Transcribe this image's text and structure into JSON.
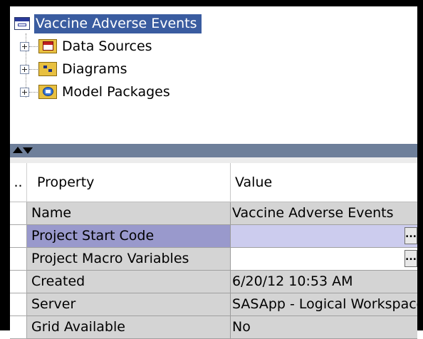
{
  "tree": {
    "root_label": "Vaccine Adverse Events",
    "nodes": [
      {
        "label": "Data Sources",
        "icon": "data-sources-folder-icon"
      },
      {
        "label": "Diagrams",
        "icon": "diagrams-folder-icon"
      },
      {
        "label": "Model Packages",
        "icon": "model-packages-folder-icon"
      }
    ]
  },
  "table": {
    "header_marker": "..",
    "col_property": "Property",
    "col_value": "Value",
    "button_label": "...",
    "rows": [
      {
        "property": "Name",
        "value": "Vaccine Adverse Events"
      },
      {
        "property": "Project Start Code",
        "value": ""
      },
      {
        "property": "Project Macro Variables",
        "value": ""
      },
      {
        "property": "Created",
        "value": "6/20/12 10:53 AM"
      },
      {
        "property": "Server",
        "value": "SASApp - Logical Workspace Server"
      },
      {
        "property": "Grid Available",
        "value": "No"
      }
    ]
  },
  "colors": {
    "selection_blue": "#3a5ca0",
    "selected_property": "#9999cc",
    "selected_value": "#ccccee",
    "splitter": "#6e7f9a"
  }
}
